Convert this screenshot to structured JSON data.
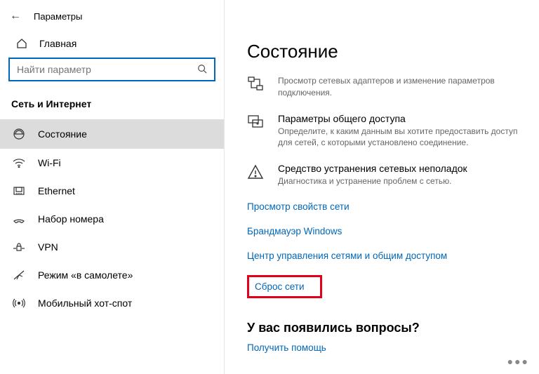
{
  "window": {
    "title": "Параметры"
  },
  "sidebar": {
    "home": "Главная",
    "search_placeholder": "Найти параметр",
    "category": "Сеть и Интернет",
    "items": [
      {
        "label": "Состояние"
      },
      {
        "label": "Wi-Fi"
      },
      {
        "label": "Ethernet"
      },
      {
        "label": "Набор номера"
      },
      {
        "label": "VPN"
      },
      {
        "label": "Режим «в самолете»"
      },
      {
        "label": "Мобильный хот-спот"
      }
    ]
  },
  "main": {
    "title": "Состояние",
    "adapters": {
      "heading": "",
      "desc": "Просмотр сетевых адаптеров и изменение параметров подключения."
    },
    "sharing": {
      "heading": "Параметры общего доступа",
      "desc": "Определите, к каким данным вы хотите предоставить доступ для сетей, с которыми установлено соединение."
    },
    "troubleshoot": {
      "heading": "Средство устранения сетевых неполадок",
      "desc": "Диагностика и устранение проблем с сетью."
    },
    "links": {
      "properties": "Просмотр свойств сети",
      "firewall": "Брандмауэр Windows",
      "center": "Центр управления сетями и общим доступом",
      "reset": "Сброс сети",
      "help": "Получить помощь"
    },
    "questions": "У вас появились вопросы?"
  }
}
